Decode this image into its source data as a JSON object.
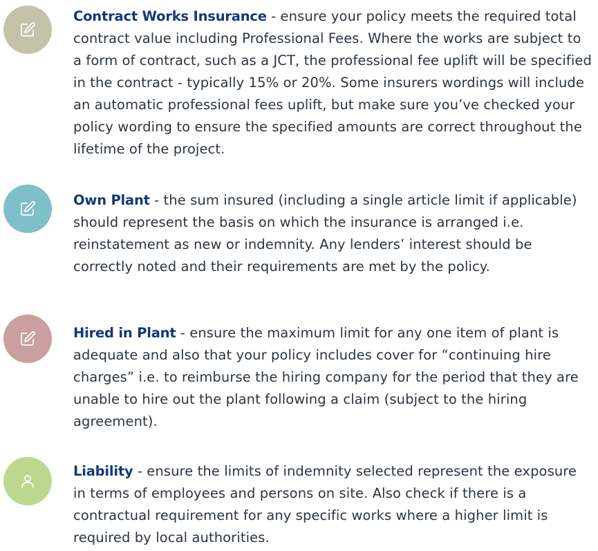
{
  "items": [
    {
      "title": "Contract Works Insurance",
      "body": " - ensure your policy meets the required total contract value including Professional Fees. Where the works are subject to a form of contract, such as a JCT, the professional fee uplift will be specified in the contract - typically 15% or 20%.  Some insurers wordings will include an automatic professional fees uplift, but make sure you’ve checked your policy wording to ensure the specified amounts are correct throughout the lifetime of the project.",
      "icon": "edit-icon",
      "color": "#c6c2a8"
    },
    {
      "title": "Own Plant",
      "body": " - the sum insured (including a single article limit if applicable) should represent the basis on which the insurance is arranged i.e. reinstatement as new or indemnity. Any lenders’ interest should be correctly noted and their requirements are met by the policy.",
      "icon": "edit-icon",
      "color": "#7ebfc9"
    },
    {
      "title": "Hired in Plant",
      "body": " - ensure the maximum limit for any one item of plant is adequate and also that your policy includes cover for “continuing hire charges” i.e. to reimburse the hiring company for the period that they are unable to hire out the plant following a claim (subject to the hiring agreement).",
      "icon": "edit-icon",
      "color": "#cb9f9f"
    },
    {
      "title": "Liability",
      "body": " - ensure the limits of indemnity selected represent the exposure in terms of employees and persons on site. Also check if there is a contractual requirement for any specific works where a higher limit is required by local authorities.",
      "icon": "user-icon",
      "color": "#bcd88f"
    }
  ]
}
